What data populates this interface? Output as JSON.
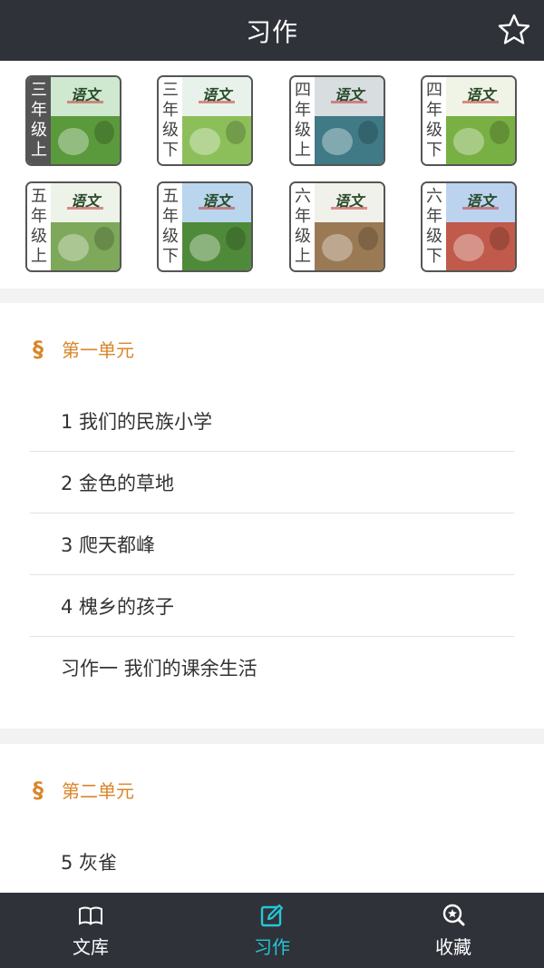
{
  "header": {
    "title": "习作",
    "favorite_icon": "star-outline-icon"
  },
  "books": [
    {
      "label_chars": [
        "三",
        "年",
        "级",
        "上"
      ],
      "selected": true,
      "cover_title": "语文",
      "sky": "#cfe8d0",
      "ground": "#5a9a3c"
    },
    {
      "label_chars": [
        "三",
        "年",
        "级",
        "下"
      ],
      "selected": false,
      "cover_title": "语文",
      "sky": "#e8f2ea",
      "ground": "#8cbf5a"
    },
    {
      "label_chars": [
        "四",
        "年",
        "级",
        "上"
      ],
      "selected": false,
      "cover_title": "语文",
      "sky": "#d8dde0",
      "ground": "#3f7a86"
    },
    {
      "label_chars": [
        "四",
        "年",
        "级",
        "下"
      ],
      "selected": false,
      "cover_title": "语文",
      "sky": "#f0f4e6",
      "ground": "#79b043"
    },
    {
      "label_chars": [
        "五",
        "年",
        "级",
        "上"
      ],
      "selected": false,
      "cover_title": "语文",
      "sky": "#eef3ea",
      "ground": "#7ea85a"
    },
    {
      "label_chars": [
        "五",
        "年",
        "级",
        "下"
      ],
      "selected": false,
      "cover_title": "语文",
      "sky": "#b9d6ee",
      "ground": "#4f8a3a"
    },
    {
      "label_chars": [
        "六",
        "年",
        "级",
        "上"
      ],
      "selected": false,
      "cover_title": "语文",
      "sky": "#f1f1ec",
      "ground": "#9a7a54"
    },
    {
      "label_chars": [
        "六",
        "年",
        "级",
        "下"
      ],
      "selected": false,
      "cover_title": "语文",
      "sky": "#bcd3f0",
      "ground": "#c05a4a"
    }
  ],
  "units": [
    {
      "section_icon": "section-sign-icon",
      "symbol": "§",
      "title": "第一单元",
      "lessons": [
        "1 我们的民族小学",
        "2 金色的草地",
        "3 爬天都峰",
        "4 槐乡的孩子",
        "习作一 我们的课余生活"
      ]
    },
    {
      "section_icon": "section-sign-icon",
      "symbol": "§",
      "title": "第二单元",
      "lessons": [
        "5 灰雀"
      ]
    }
  ],
  "tabbar": {
    "tabs": [
      {
        "label": "文库",
        "icon": "open-book-icon",
        "active": false
      },
      {
        "label": "习作",
        "icon": "edit-icon",
        "active": true
      },
      {
        "label": "收藏",
        "icon": "favorites-search-icon",
        "active": false
      }
    ],
    "active_color": "#25c6d9",
    "inactive_color": "#ffffff"
  },
  "colors": {
    "header_bg": "#2f3239",
    "accent": "#d9852a"
  }
}
